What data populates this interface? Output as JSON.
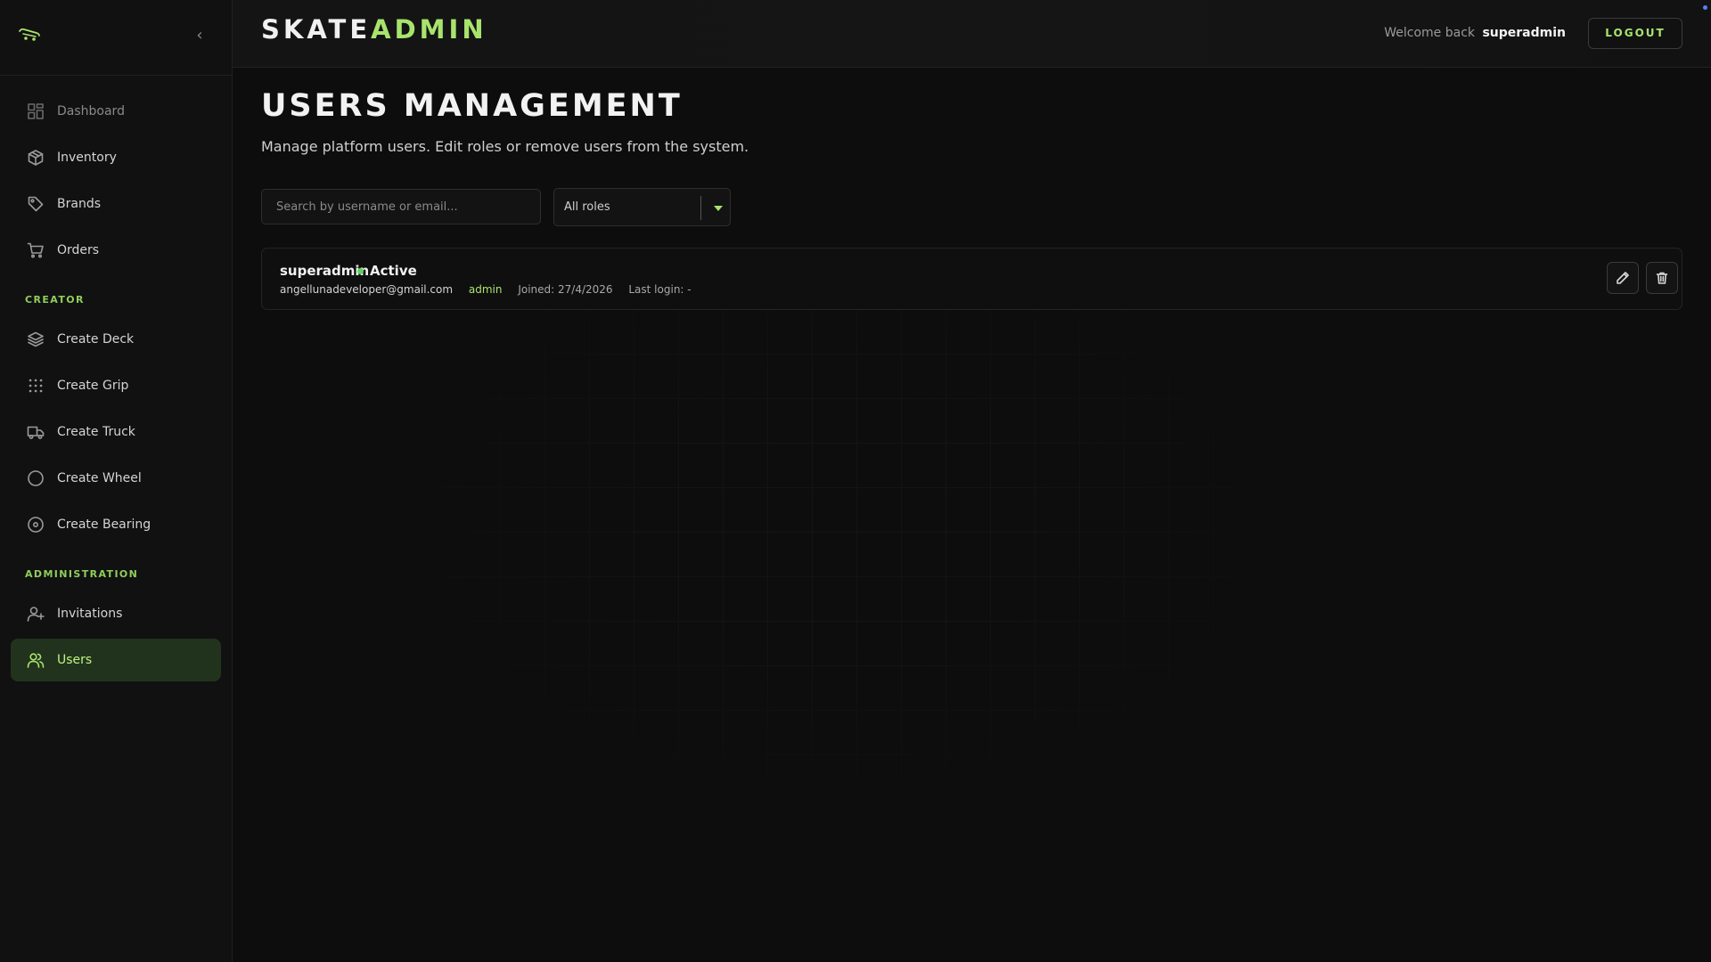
{
  "sidebar": {
    "collapse_glyph": "‹",
    "items_top": [
      {
        "label": "Dashboard",
        "icon": "dashboard-icon"
      },
      {
        "label": "Inventory",
        "icon": "box-icon"
      },
      {
        "label": "Brands",
        "icon": "tag-icon"
      },
      {
        "label": "Orders",
        "icon": "cart-icon"
      }
    ],
    "creator_label": "CREATOR",
    "items_creator": [
      {
        "label": "Create Deck",
        "icon": "layers-icon"
      },
      {
        "label": "Create Grip",
        "icon": "grid-dots-icon"
      },
      {
        "label": "Create Truck",
        "icon": "truck-icon"
      },
      {
        "label": "Create Wheel",
        "icon": "circle-icon"
      },
      {
        "label": "Create Bearing",
        "icon": "disc-icon"
      }
    ],
    "admin_label": "ADMINISTRATION",
    "items_admin": [
      {
        "label": "Invitations",
        "icon": "user-plus-icon"
      },
      {
        "label": "Users",
        "icon": "users-icon"
      }
    ],
    "active_item": "Users"
  },
  "header": {
    "brand_part1": "SKATE",
    "brand_part2": "ADMIN",
    "welcome_text": "Welcome back",
    "username": "superadmin",
    "logout_label": "LOGOUT"
  },
  "main": {
    "title": "USERS MANAGEMENT",
    "subtitle": "Manage platform users. Edit roles or remove users from the system.",
    "search_placeholder": "Search by username or email...",
    "role_filter_value": "All roles",
    "users": [
      {
        "username": "superadmin",
        "status": "Active",
        "email": "angellunadeveloper@gmail.com",
        "role": "admin",
        "joined": "Joined: 27/4/2026",
        "last_login": "Last login: -"
      }
    ]
  },
  "colors": {
    "accent": "#a8e46d",
    "active_bg": "#22331d",
    "status_active": "#5fd35a",
    "background": "#0d0d0d"
  }
}
